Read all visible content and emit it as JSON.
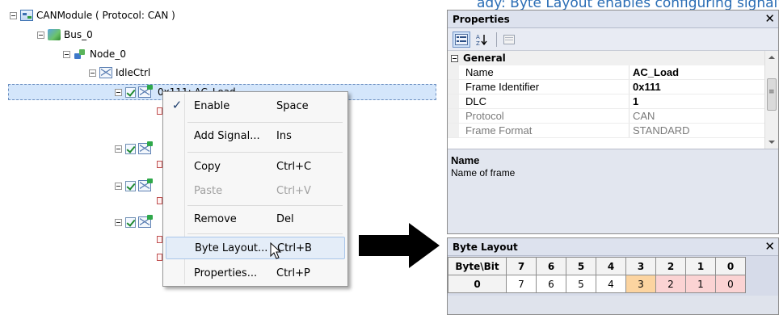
{
  "header_fragment": "ady: Byte Layout enables configuring signal's",
  "tree": {
    "module": "CANModule ( Protocol: CAN )",
    "bus": "Bus_0",
    "node": "Node_0",
    "idle": "IdleCtrl",
    "selected_frame": "0x111: AC_Load"
  },
  "context_menu": {
    "items": [
      {
        "label": "Enable",
        "shortcut": "Space",
        "checked": true,
        "disabled": false
      },
      {
        "label": "Add Signal...",
        "shortcut": "Ins",
        "checked": false,
        "disabled": false
      },
      {
        "label": "Copy",
        "shortcut": "Ctrl+C",
        "checked": false,
        "disabled": false
      },
      {
        "label": "Paste",
        "shortcut": "Ctrl+V",
        "checked": false,
        "disabled": true
      },
      {
        "label": "Remove",
        "shortcut": "Del",
        "checked": false,
        "disabled": false
      },
      {
        "label": "Byte Layout...",
        "shortcut": "Ctrl+B",
        "checked": false,
        "disabled": false,
        "hover": true
      },
      {
        "label": "Properties...",
        "shortcut": "Ctrl+P",
        "checked": false,
        "disabled": false
      }
    ],
    "check_glyph": "✓"
  },
  "properties": {
    "title": "Properties",
    "close": "✕",
    "toolbar": {
      "categorized_icon": "categorized-icon",
      "alpha_sort_icon": "az-sort-icon",
      "property_pages_icon": "property-pages-icon"
    },
    "category": "General",
    "rows": [
      {
        "name": "Name",
        "value": "AC_Load",
        "bold": true,
        "readonly": false
      },
      {
        "name": "Frame Identifier",
        "value": "0x111",
        "bold": true,
        "readonly": false
      },
      {
        "name": "DLC",
        "value": "1",
        "bold": true,
        "readonly": false
      },
      {
        "name": "Protocol",
        "value": "CAN",
        "bold": false,
        "readonly": true
      },
      {
        "name": "Frame Format",
        "value": "STANDARD",
        "bold": false,
        "readonly": true
      }
    ],
    "description_title": "Name",
    "description_text": "Name of frame"
  },
  "byte_layout": {
    "title": "Byte Layout",
    "close": "✕",
    "header": [
      "Byte\\Bit",
      "7",
      "6",
      "5",
      "4",
      "3",
      "2",
      "1",
      "0"
    ],
    "rows": [
      {
        "byte": "0",
        "cells": [
          "7",
          "6",
          "5",
          "4",
          "3",
          "2",
          "1",
          "0"
        ],
        "colors": [
          "#ffffff",
          "#ffffff",
          "#ffffff",
          "#ffffff",
          "#fcd4a0",
          "#fbd3d3",
          "#fbd3d3",
          "#fbd3d3"
        ]
      }
    ]
  },
  "colors": {
    "selection": "#d4e6fb",
    "menu_hover": "#e4edf8",
    "signal_orange": "#fcd4a0",
    "signal_pink": "#fbd3d3"
  }
}
